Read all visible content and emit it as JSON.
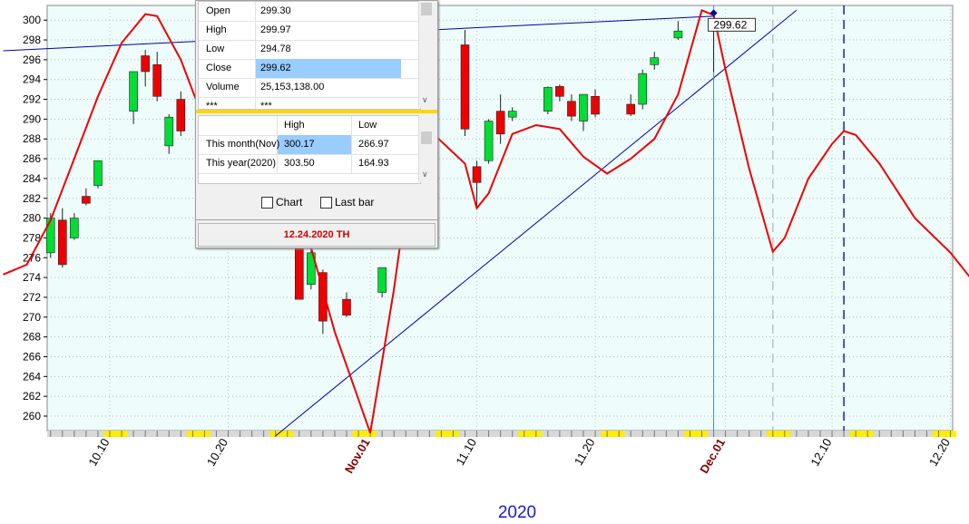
{
  "chart_data": {
    "type": "candlestick",
    "year_label": "2020",
    "ylim": [
      258,
      301
    ],
    "y_ticks": [
      260,
      262,
      264,
      266,
      268,
      270,
      272,
      274,
      276,
      278,
      280,
      282,
      284,
      286,
      288,
      290,
      292,
      294,
      296,
      298,
      300
    ],
    "x_ticks": [
      {
        "label": "10.10",
        "date": "2020-10-10",
        "style": "normal"
      },
      {
        "label": "10.20",
        "date": "2020-10-20",
        "style": "normal"
      },
      {
        "label": "Nov.01",
        "date": "2020-11-01",
        "style": "month"
      },
      {
        "label": "11.10",
        "date": "2020-11-10",
        "style": "normal"
      },
      {
        "label": "11.20",
        "date": "2020-11-20",
        "style": "normal"
      },
      {
        "label": "Dec.01",
        "date": "2020-12-01",
        "style": "month"
      },
      {
        "label": "12.10",
        "date": "2020-12-10",
        "style": "normal"
      },
      {
        "label": "12.20",
        "date": "2020-12-20",
        "style": "normal"
      }
    ],
    "candles": [
      {
        "date": "2020-10-05",
        "open": 276.5,
        "high": 280.5,
        "low": 276.0,
        "close": 280.0
      },
      {
        "date": "2020-10-06",
        "open": 279.8,
        "high": 281.0,
        "low": 275.0,
        "close": 275.3
      },
      {
        "date": "2020-10-07",
        "open": 278.0,
        "high": 280.5,
        "low": 277.8,
        "close": 280.0
      },
      {
        "date": "2020-10-08",
        "open": 282.2,
        "high": 283.0,
        "low": 281.3,
        "close": 281.5
      },
      {
        "date": "2020-10-09",
        "open": 283.3,
        "high": 285.8,
        "low": 283.0,
        "close": 285.8
      },
      {
        "date": "2020-10-12",
        "open": 290.8,
        "high": 294.8,
        "low": 289.5,
        "close": 294.8
      },
      {
        "date": "2020-10-13",
        "open": 296.4,
        "high": 297.0,
        "low": 293.3,
        "close": 294.8
      },
      {
        "date": "2020-10-14",
        "open": 295.5,
        "high": 296.8,
        "low": 291.8,
        "close": 292.3
      },
      {
        "date": "2020-10-15",
        "open": 287.3,
        "high": 290.5,
        "low": 286.5,
        "close": 290.2
      },
      {
        "date": "2020-10-16",
        "open": 292.0,
        "high": 292.8,
        "low": 288.3,
        "close": 288.8
      },
      {
        "date": "2020-10-26",
        "open": 278.0,
        "high": 279.0,
        "low": 272.0,
        "close": 271.8
      },
      {
        "date": "2020-10-27",
        "open": 273.3,
        "high": 277.5,
        "low": 272.8,
        "close": 276.5
      },
      {
        "date": "2020-10-28",
        "open": 274.5,
        "high": 274.8,
        "low": 268.3,
        "close": 269.6
      },
      {
        "date": "2020-10-30",
        "open": 271.8,
        "high": 272.5,
        "low": 270.0,
        "close": 270.2
      },
      {
        "date": "2020-11-02",
        "open": 272.5,
        "high": 275.0,
        "low": 272.0,
        "close": 275.0
      },
      {
        "date": "2020-11-09",
        "open": 297.5,
        "high": 299.0,
        "low": 288.3,
        "close": 289.0
      },
      {
        "date": "2020-11-10",
        "open": 285.2,
        "high": 285.8,
        "low": 281.0,
        "close": 283.6
      },
      {
        "date": "2020-11-11",
        "open": 285.8,
        "high": 290.0,
        "low": 285.5,
        "close": 289.8
      },
      {
        "date": "2020-11-12",
        "open": 290.8,
        "high": 292.5,
        "low": 287.5,
        "close": 288.5
      },
      {
        "date": "2020-11-13",
        "open": 290.2,
        "high": 291.2,
        "low": 289.8,
        "close": 290.8
      },
      {
        "date": "2020-11-16",
        "open": 290.8,
        "high": 293.3,
        "low": 290.5,
        "close": 293.2
      },
      {
        "date": "2020-11-17",
        "open": 293.3,
        "high": 293.5,
        "low": 291.8,
        "close": 292.3
      },
      {
        "date": "2020-11-18",
        "open": 291.8,
        "high": 292.5,
        "low": 289.8,
        "close": 290.3
      },
      {
        "date": "2020-11-19",
        "open": 289.8,
        "high": 292.5,
        "low": 288.8,
        "close": 292.5
      },
      {
        "date": "2020-11-20",
        "open": 292.3,
        "high": 293.0,
        "low": 290.2,
        "close": 290.5
      },
      {
        "date": "2020-11-23",
        "open": 291.5,
        "high": 292.5,
        "low": 290.3,
        "close": 290.5
      },
      {
        "date": "2020-11-24",
        "open": 291.5,
        "high": 295.0,
        "low": 291.0,
        "close": 294.6
      },
      {
        "date": "2020-11-25",
        "open": 295.5,
        "high": 296.8,
        "low": 295.0,
        "close": 296.2
      },
      {
        "date": "2020-11-27",
        "open": 298.2,
        "high": 299.9,
        "low": 298.0,
        "close": 298.9
      },
      {
        "date": "2020-11-30",
        "open": 299.3,
        "high": 299.97,
        "low": 294.78,
        "close": 299.62
      }
    ],
    "forecast_line": [
      {
        "date": "2020-10-01",
        "value": 274.3
      },
      {
        "date": "2020-10-03",
        "value": 275.3
      },
      {
        "date": "2020-10-05",
        "value": 279.8
      },
      {
        "date": "2020-10-07",
        "value": 286.0
      },
      {
        "date": "2020-10-09",
        "value": 292.3
      },
      {
        "date": "2020-10-11",
        "value": 297.7
      },
      {
        "date": "2020-10-13",
        "value": 300.6
      },
      {
        "date": "2020-10-14",
        "value": 300.4
      },
      {
        "date": "2020-10-16",
        "value": 296.0
      },
      {
        "date": "2020-10-18",
        "value": 289.7
      },
      {
        "date": "2020-10-20",
        "value": 285.8
      },
      {
        "date": "2020-10-27",
        "value": 277.0
      },
      {
        "date": "2020-10-29",
        "value": 268.5
      },
      {
        "date": "2020-11-01",
        "value": 258.3
      },
      {
        "date": "2020-11-03",
        "value": 272.8
      },
      {
        "date": "2020-11-05",
        "value": 290.0
      },
      {
        "date": "2020-11-09",
        "value": 285.5
      },
      {
        "date": "2020-11-10",
        "value": 281.0
      },
      {
        "date": "2020-11-11",
        "value": 282.5
      },
      {
        "date": "2020-11-13",
        "value": 288.5
      },
      {
        "date": "2020-11-15",
        "value": 289.4
      },
      {
        "date": "2020-11-17",
        "value": 289.0
      },
      {
        "date": "2020-11-19",
        "value": 286.2
      },
      {
        "date": "2020-11-21",
        "value": 284.5
      },
      {
        "date": "2020-11-23",
        "value": 286.0
      },
      {
        "date": "2020-11-25",
        "value": 288.0
      },
      {
        "date": "2020-11-27",
        "value": 292.5
      },
      {
        "date": "2020-11-29",
        "value": 301.0
      },
      {
        "date": "2020-11-30",
        "value": 300.5
      },
      {
        "date": "2020-12-01",
        "value": 295.0
      },
      {
        "date": "2020-12-03",
        "value": 285.0
      },
      {
        "date": "2020-12-05",
        "value": 276.6
      },
      {
        "date": "2020-12-06",
        "value": 278.0
      },
      {
        "date": "2020-12-08",
        "value": 284.0
      },
      {
        "date": "2020-12-10",
        "value": 287.5
      },
      {
        "date": "2020-12-11",
        "value": 288.8
      },
      {
        "date": "2020-12-12",
        "value": 288.4
      },
      {
        "date": "2020-12-14",
        "value": 285.5
      },
      {
        "date": "2020-12-17",
        "value": 280.0
      },
      {
        "date": "2020-12-20",
        "value": 276.5
      },
      {
        "date": "2020-12-22",
        "value": 273.5
      }
    ],
    "trendlines": [
      {
        "name": "upper",
        "color": "#0000aa",
        "start": {
          "date": "2020-10-01",
          "value": 296.9
        },
        "end": {
          "date": "2020-11-30",
          "value": 300.4
        }
      },
      {
        "name": "lower",
        "color": "#0000aa",
        "start": {
          "date": "2020-10-24",
          "value": 258.0
        },
        "end": {
          "date": "2020-12-07",
          "value": 301.0
        }
      }
    ],
    "vertical_markers": [
      {
        "date": "2020-11-30",
        "color": "#4488cc",
        "style": "solid"
      },
      {
        "date": "2020-12-05",
        "color": "#bbbbbb",
        "style": "dashed"
      },
      {
        "date": "2020-12-11",
        "color": "#000088",
        "style": "dashed"
      }
    ],
    "last_price": {
      "date": "2020-11-30",
      "label": "299.62",
      "value": 299.62
    },
    "colors": {
      "up": "#00dd33",
      "down": "#ee0000",
      "forecast": "#ee0000",
      "background": "#eefcfc",
      "tick_bar": "#ffee00"
    }
  },
  "info_panel": {
    "quote_rows": [
      {
        "label": "Open",
        "value": "299.30"
      },
      {
        "label": "High",
        "value": "299.97"
      },
      {
        "label": "Low",
        "value": "294.78"
      },
      {
        "label": "Close",
        "value": "299.62"
      },
      {
        "label": "Volume",
        "value": "25,153,138.00"
      },
      {
        "label": "***",
        "value": "***"
      }
    ],
    "range_header": {
      "col1": "",
      "col2": "High",
      "col3": "Low"
    },
    "range_rows": [
      {
        "label": "This month(Nov)",
        "high": "300.17",
        "low": "266.97"
      },
      {
        "label": "This year(2020)",
        "high": "303.50",
        "low": "164.93"
      }
    ],
    "checkbox_chart": "Chart",
    "checkbox_lastbar": "Last bar",
    "date_label": "12.24.2020 TH"
  }
}
